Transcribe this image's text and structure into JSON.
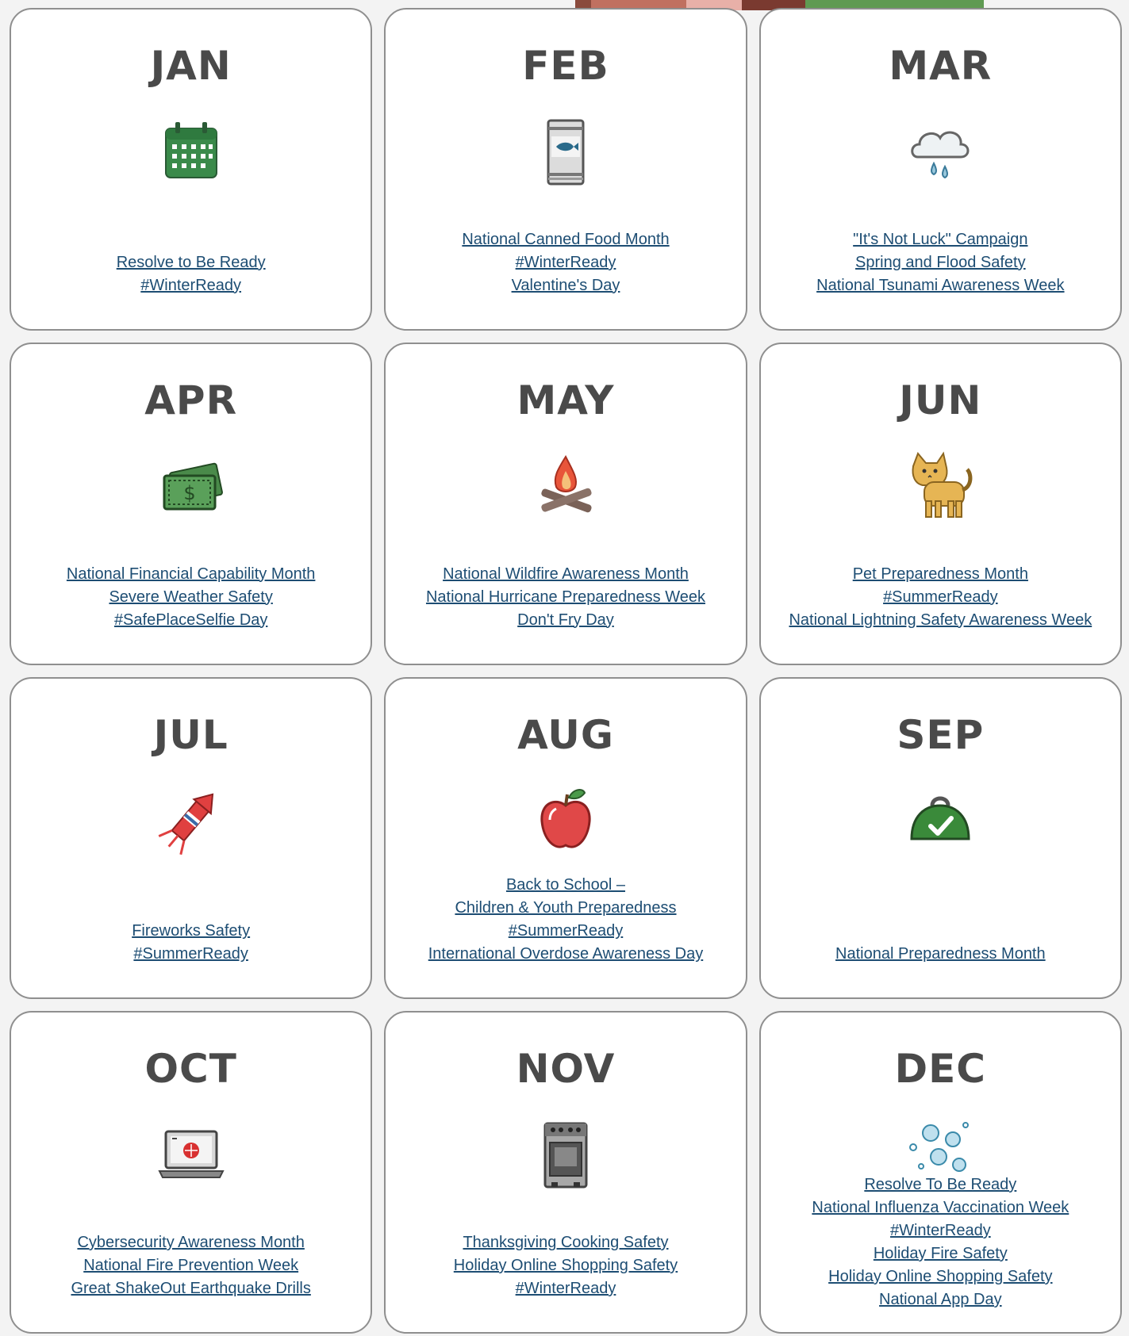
{
  "months": [
    {
      "name": "JAN",
      "icon": "calendar-icon",
      "links": [
        "Resolve to Be Ready",
        "#WinterReady"
      ]
    },
    {
      "name": "FEB",
      "icon": "canned-food-icon",
      "links": [
        "National Canned Food Month",
        "#WinterReady",
        "Valentine's Day"
      ]
    },
    {
      "name": "MAR",
      "icon": "rain-cloud-icon",
      "links": [
        "\"It's Not Luck\" Campaign",
        "Spring and Flood Safety",
        "National Tsunami Awareness Week"
      ]
    },
    {
      "name": "APR",
      "icon": "money-icon",
      "links": [
        "National Financial Capability Month",
        "Severe Weather Safety",
        "#SafePlaceSelfie Day"
      ]
    },
    {
      "name": "MAY",
      "icon": "campfire-icon",
      "links": [
        "National Wildfire Awareness Month",
        "National Hurricane Preparedness Week",
        "Don't Fry Day"
      ]
    },
    {
      "name": "JUN",
      "icon": "cat-icon",
      "links": [
        "Pet Preparedness Month",
        "#SummerReady",
        "National Lightning Safety Awareness Week"
      ]
    },
    {
      "name": "JUL",
      "icon": "firework-rocket-icon",
      "links": [
        "Fireworks Safety",
        "#SummerReady"
      ]
    },
    {
      "name": "AUG",
      "icon": "apple-icon",
      "links": [
        "Back to School –",
        "Children & Youth Preparedness",
        "#SummerReady",
        "International Overdose Awareness Day"
      ]
    },
    {
      "name": "SEP",
      "icon": "emergency-kit-icon",
      "links": [
        "National Preparedness Month"
      ]
    },
    {
      "name": "OCT",
      "icon": "laptop-icon",
      "links": [
        "Cybersecurity Awareness Month",
        "National Fire Prevention Week",
        "Great ShakeOut Earthquake Drills"
      ]
    },
    {
      "name": "NOV",
      "icon": "oven-icon",
      "links": [
        "Thanksgiving Cooking Safety",
        "Holiday Online Shopping Safety",
        "#WinterReady"
      ]
    },
    {
      "name": "DEC",
      "icon": "snowflakes-icon",
      "links": [
        "Resolve To Be Ready",
        "National Influenza Vaccination Week",
        "#WinterReady",
        "Holiday Fire Safety",
        "Holiday Online Shopping Safety",
        "National App Day"
      ]
    }
  ],
  "colors": {
    "link": "#1d4d73",
    "month": "#4a4a4a",
    "card_border": "#8f8f8f"
  }
}
